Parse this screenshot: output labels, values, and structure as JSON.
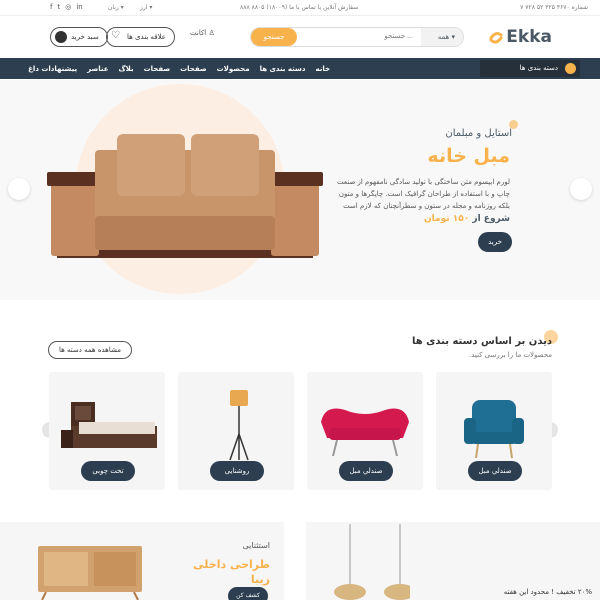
{
  "topbar": {
    "phone": "شماره ۴۶۷۰ ۳۲۵ ۵۲ ۷۲۸ ۷",
    "hint": "سفارش آنلاین یا تماس با ما (۱۸۰۰۹) ۸۸۰۵ ۸۸۸",
    "currency": "ارز",
    "language": "زبان",
    "social": [
      "f",
      "t",
      "in",
      "ig",
      "in"
    ]
  },
  "header": {
    "logo": "Ekka",
    "search_category": "همه",
    "search_placeholder": "جستجو ...",
    "search_button": "جستجو",
    "account": "اکانت",
    "wishlist": "علاقه بندی ها",
    "cart": "سبد خرید"
  },
  "nav": {
    "category_button": "دسته بندی ها",
    "links": [
      "خانه",
      "دسته بندی ها",
      "محصولات",
      "صفحات",
      "صفحات",
      "بلاگ",
      "عناصر",
      "پیشنهادات داغ"
    ]
  },
  "hero": {
    "subtitle": "استایل و مبلمان",
    "title": "مبل خانه",
    "description": "لورم ایپسوم متن ساختگی با تولید سادگی نامفهوم از صنعت چاپ و با استفاده از طراحان گرافیک است. چاپگرها و متون بلکه روزنامه و مجله در ستون و سطرآنچنان که لازم است",
    "price_prefix": "شروع از",
    "price": "۱۵۰ تومان",
    "buy_button": "خرید"
  },
  "categories": {
    "heading": "دیدن بر اساس دسته بندی ها",
    "subheading": "محصولات ما را بررسی کنید.",
    "view_all": "مشاهده همه دسته ها",
    "items": [
      {
        "label": "صندلي مبل",
        "icon": "armchair"
      },
      {
        "label": "صندلي مبل",
        "icon": "sofa"
      },
      {
        "label": "روشنایی",
        "icon": "lamp"
      },
      {
        "label": "تخت چوبی",
        "icon": "bed"
      }
    ]
  },
  "banners": {
    "left_sub": "استثنایی",
    "left_title_1": "طراحی داخلی",
    "left_title_2": "زیبا",
    "left_button": "کشف کن",
    "right_text": "۲۰% تخفیف ! محدود این هفته"
  },
  "colors": {
    "accent": "#f8b24c",
    "nav": "#2c3e50",
    "text": "#4b5966"
  }
}
